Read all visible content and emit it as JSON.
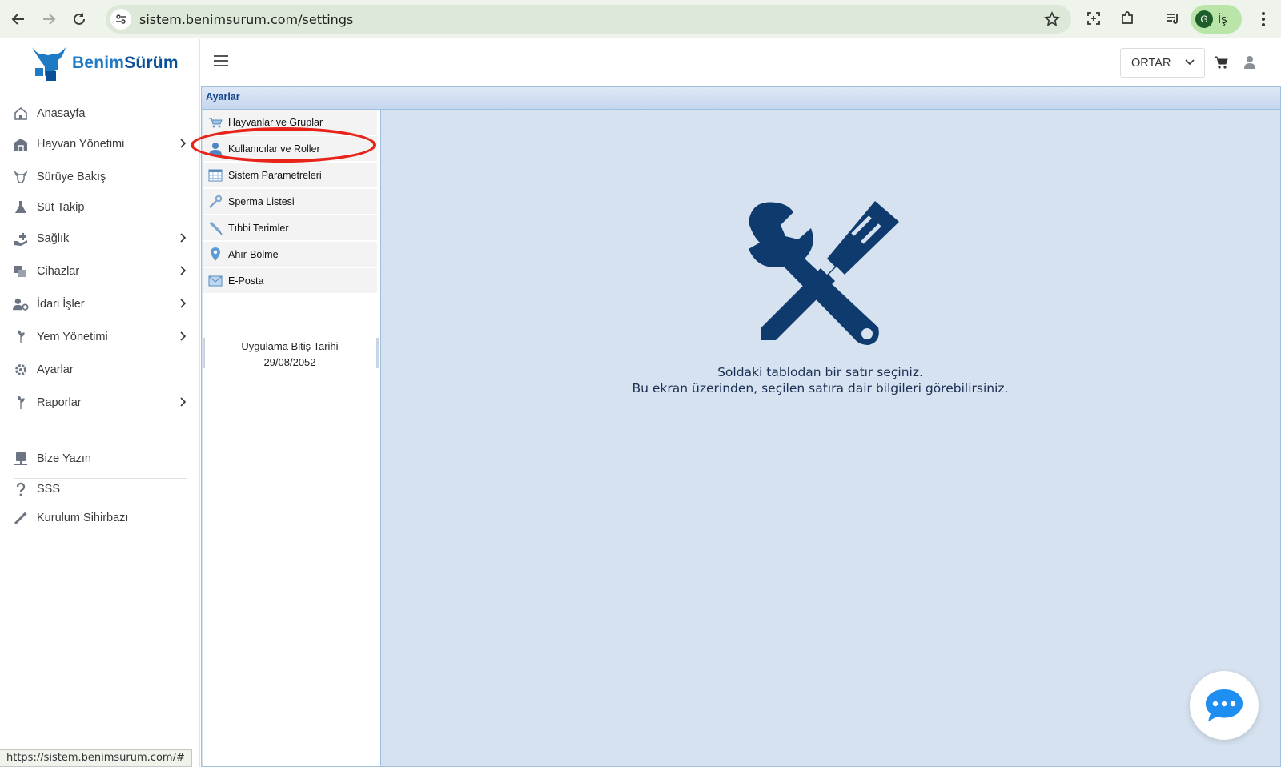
{
  "browser": {
    "url": "sistem.benimsurum.com/settings",
    "profile_initial": "G",
    "profile_label": "İş",
    "status_url": "https://sistem.benimsurum.com/#"
  },
  "logo": {
    "part1": "Benim",
    "part2": "Sürüm"
  },
  "sidebar": {
    "items": [
      {
        "label": "Anasayfa",
        "icon": "home-icon"
      },
      {
        "label": "Hayvan Yönetimi",
        "icon": "barn-icon"
      },
      {
        "label": "Sürüye Bakış",
        "icon": "cow-icon"
      },
      {
        "label": "Süt Takip",
        "icon": "flask-icon"
      },
      {
        "label": "Sağlık",
        "icon": "health-icon"
      },
      {
        "label": "Cihazlar",
        "icon": "devices-icon"
      },
      {
        "label": "İdari İşler",
        "icon": "users-gear-icon"
      },
      {
        "label": "Yem Yönetimi",
        "icon": "feed-icon"
      },
      {
        "label": "Ayarlar",
        "icon": "gear-icon"
      },
      {
        "label": "Raporlar",
        "icon": "report-icon"
      }
    ],
    "bottom_items": [
      {
        "label": "Bize Yazın",
        "icon": "contact-icon"
      },
      {
        "label": "SSS",
        "icon": "question-icon"
      },
      {
        "label": "Kurulum Sihirbazı",
        "icon": "wand-icon"
      }
    ]
  },
  "header": {
    "farm_select": "ORTAR"
  },
  "settings": {
    "title": "Ayarlar",
    "items": [
      {
        "label": "Hayvanlar ve Gruplar",
        "icon": "cart-animal-icon"
      },
      {
        "label": "Kullanıcılar ve Roller",
        "icon": "user-icon"
      },
      {
        "label": "Sistem Parametreleri",
        "icon": "table-icon"
      },
      {
        "label": "Sperma Listesi",
        "icon": "pipette-icon"
      },
      {
        "label": "Tıbbi Terimler",
        "icon": "syringe-icon"
      },
      {
        "label": "Ahır-Bölme",
        "icon": "location-pin-icon"
      },
      {
        "label": "E-Posta",
        "icon": "envelope-icon"
      }
    ],
    "expiry_label": "Uygulama Bitiş Tarihi",
    "expiry_date": "29/08/2052",
    "message_line1": "Soldaki tablodan bir satır seçiniz.",
    "message_line2": "Bu ekran üzerinden, seçilen satıra dair bilgileri görebilirsiniz."
  },
  "colors": {
    "brand_blue": "#1e7ac4",
    "panel_bg": "#d6e2f0",
    "tool_icon": "#0e3a6e",
    "highlight": "#e8241a"
  }
}
